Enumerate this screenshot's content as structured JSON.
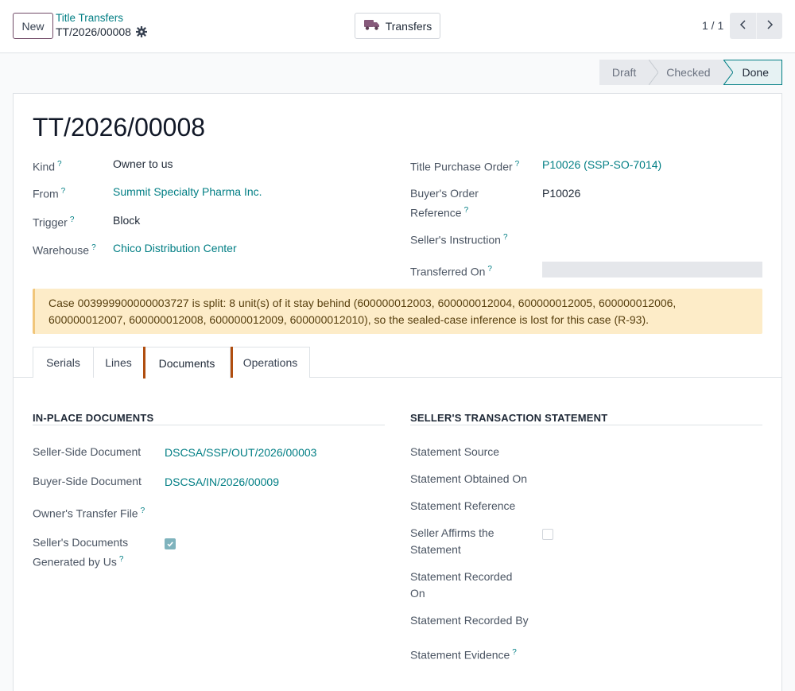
{
  "control_panel": {
    "new_label": "New",
    "breadcrumb_parent": "Title Transfers",
    "breadcrumb_current": "TT/2026/00008",
    "smart_button_label": "Transfers",
    "pager": "1 / 1"
  },
  "statusbar": {
    "stages": [
      "Draft",
      "Checked",
      "Done"
    ],
    "active": "Done"
  },
  "record": {
    "title": "TT/2026/00008",
    "left": {
      "kind_label": "Kind",
      "kind_value": "Owner to us",
      "from_label": "From",
      "from_value": "Summit Specialty Pharma Inc.",
      "trigger_label": "Trigger",
      "trigger_value": "Block",
      "warehouse_label": "Warehouse",
      "warehouse_value": "Chico Distribution Center"
    },
    "right": {
      "tpo_label": "Title Purchase Order",
      "tpo_value": "P10026 (SSP-SO-7014)",
      "buyer_ref_label_1": "Buyer's Order",
      "buyer_ref_label_2": "Reference",
      "buyer_ref_value": "P10026",
      "seller_instr_label": "Seller's Instruction",
      "transferred_on_label": "Transferred On"
    },
    "alert_line_1": "Case 003999900000003727 is split: 8 unit(s) of it stay behind (600000012003, 600000012004, 600000012005, 600000012006,",
    "alert_line_2": "600000012007, 600000012008, 600000012009, 600000012010), so the sealed-case inference is lost for this case (R-93).",
    "help_mark": "?"
  },
  "tabs": [
    {
      "label": "Serials"
    },
    {
      "label": "Lines"
    },
    {
      "label": "Documents"
    },
    {
      "label": "Operations"
    }
  ],
  "active_tab": "Documents",
  "documents": {
    "in_place_title": "IN-PLACE DOCUMENTS",
    "seller_doc_label": "Seller-Side Document",
    "seller_doc_value": "DSCSA/SSP/OUT/2026/00003",
    "buyer_doc_label": "Buyer-Side Document",
    "buyer_doc_value": "DSCSA/IN/2026/00009",
    "owner_file_label": "Owner's Transfer File",
    "generated_label_1": "Seller's Documents",
    "generated_label_2": "Generated by Us",
    "generated_checked": true,
    "statement_title": "SELLER'S TRANSACTION STATEMENT",
    "statement_source_label": "Statement Source",
    "statement_obtained_label": "Statement Obtained On",
    "statement_reference_label": "Statement Reference",
    "affirms_label_1": "Seller Affirms the",
    "affirms_label_2": "Statement",
    "affirms_checked": false,
    "recorded_on_label_1": "Statement Recorded",
    "recorded_on_label_2": "On",
    "recorded_by_label": "Statement Recorded By",
    "evidence_label": "Statement Evidence"
  },
  "colors": {
    "brand": "#714b67",
    "link": "#017e84",
    "alert_bg": "#fdecc8",
    "tab_accent": "#b04e0f"
  }
}
